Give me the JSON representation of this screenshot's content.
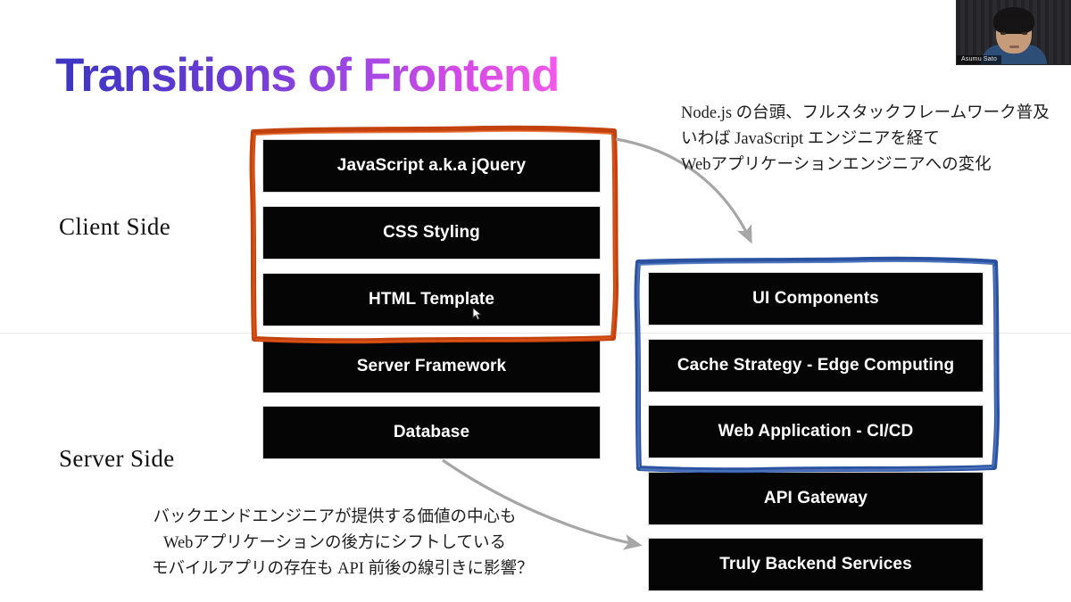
{
  "slide": {
    "title": "Transitions of Frontend",
    "background_color": "#ffffff",
    "title_gradient_start": "#3a36c0",
    "title_gradient_end": "#f25ae8"
  },
  "side_labels": {
    "client": "Client Side",
    "server": "Server Side"
  },
  "left_stack": {
    "highlight_color": "#c2410c",
    "items": [
      {
        "label": "JavaScript a.k.a jQuery",
        "highlighted": true
      },
      {
        "label": "CSS Styling",
        "highlighted": true
      },
      {
        "label": "HTML Template",
        "highlighted": true
      },
      {
        "label": "Server Framework",
        "highlighted": false
      },
      {
        "label": "Database",
        "highlighted": false
      }
    ]
  },
  "right_stack": {
    "highlight_color": "#2a52a0",
    "items": [
      {
        "label": "UI Components",
        "highlighted": true
      },
      {
        "label": "Cache Strategy - Edge Computing",
        "highlighted": true
      },
      {
        "label": "Web Application - CI/CD",
        "highlighted": true
      },
      {
        "label": "API Gateway",
        "highlighted": false
      },
      {
        "label": "Truly Backend Services",
        "highlighted": false
      }
    ]
  },
  "annotations": {
    "top_right": "Node.js の台頭、フルスタックフレームワーク普及\nいわば JavaScript エンジニアを経て\nWebアプリケーションエンジニアへの変化",
    "bottom_left": "バックエンドエンジニアが提供する価値の中心も\nWebアプリケーションの後方にシフトしている\nモバイルアプリの存在も API 前後の線引きに影響？"
  },
  "arrows": {
    "color": "#a6a6a6",
    "top_arrow_label": "client-stack-to-modern-frontend-arrow",
    "bottom_arrow_label": "database-to-backend-services-arrow"
  },
  "webcam": {
    "participant_name": "Asumu Sato"
  }
}
